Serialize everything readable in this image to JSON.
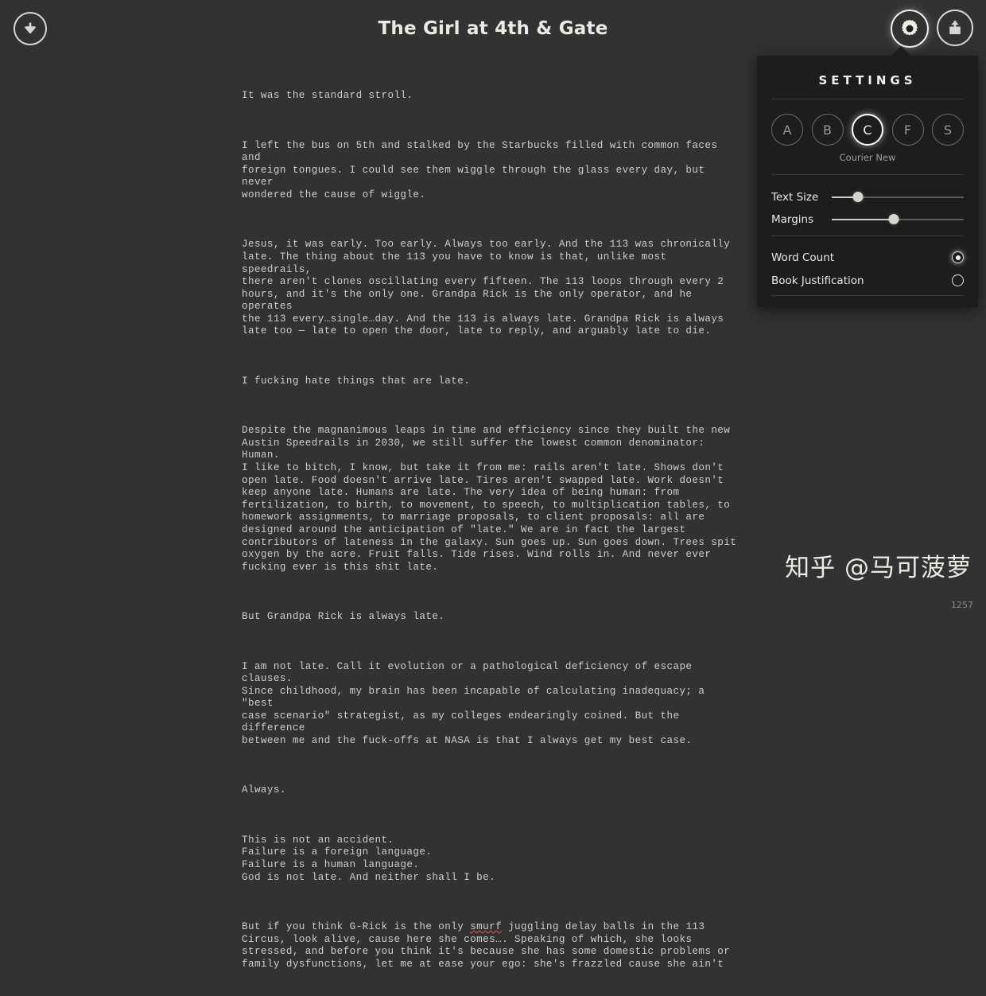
{
  "header": {
    "title": "The Girl at 4th & Gate",
    "download_icon": "arrow-down-circle-icon",
    "settings_icon": "gear-icon",
    "share_icon": "share-export-icon"
  },
  "document": {
    "paragraphs": [
      "It was the standard stroll.",
      "I left the bus on 5th and stalked by the Starbucks filled with common faces and\nforeign tongues. I could see them wiggle through the glass every day, but never\nwondered the cause of wiggle.",
      "Jesus, it was early. Too early. Always too early. And the 113 was chronically\nlate. The thing about the 113 you have to know is that, unlike most speedrails,\nthere aren't clones oscillating every fifteen. The 113 loops through every 2\nhours, and it's the only one. Grandpa Rick is the only operator, and he operates\nthe 113 every…single…day. And the 113 is always late. Grandpa Rick is always\nlate too — late to open the door, late to reply, and arguably late to die.",
      "I fucking hate things that are late.",
      "Despite the magnanimous leaps in time and efficiency since they built the new\nAustin Speedrails in 2030, we still suffer the lowest common denominator: Human.\nI like to bitch, I know, but take it from me: rails aren't late. Shows don't\nopen late. Food doesn't arrive late. Tires aren't swapped late. Work doesn't\nkeep anyone late. Humans are late. The very idea of being human: from\nfertilization, to birth, to movement, to speech, to multiplication tables, to\nhomework assignments, to marriage proposals, to client proposals: all are\ndesigned around the anticipation of \"late.\" We are in fact the largest\ncontributors of lateness in the galaxy. Sun goes up. Sun goes down. Trees spit\noxygen by the acre. Fruit falls. Tide rises. Wind rolls in. And never ever\nfucking ever is this shit late.",
      "But Grandpa Rick is always late.",
      "I am not late. Call it evolution or a pathological deficiency of escape clauses.\nSince childhood, my brain has been incapable of calculating inadequacy; a \"best\ncase scenario\" strategist, as my colleges endearingly coined. But the difference\nbetween me and the fuck-offs at NASA is that I always get my best case.",
      "Always.",
      "This is not an accident.\nFailure is a foreign language.\nFailure is a human language.\nGod is not late. And neither shall I be."
    ],
    "last_paragraph": {
      "before_misspelled": "But if you think G-Rick is the only ",
      "misspelled_word": "smurf",
      "after_misspelled": " juggling delay balls in the 113\nCircus, look alive, cause here she comes…. Speaking of which, she looks\nstressed, and before you think it's because she has some domestic problems or\nfamily dysfunctions, let me at ease your ego: she's frazzled cause she ain't"
    }
  },
  "settings": {
    "title": "SETTINGS",
    "fonts": [
      {
        "letter": "A",
        "selected": false
      },
      {
        "letter": "B",
        "selected": false
      },
      {
        "letter": "C",
        "selected": true
      },
      {
        "letter": "F",
        "selected": false
      },
      {
        "letter": "S",
        "selected": false
      }
    ],
    "selected_font_name": "Courier New",
    "sliders": [
      {
        "label": "Text Size",
        "value": 20
      },
      {
        "label": "Margins",
        "value": 47
      }
    ],
    "toggles": [
      {
        "label": "Word Count",
        "selected": true
      },
      {
        "label": "Book Justification",
        "selected": false
      }
    ]
  },
  "footer": {
    "watermark": "知乎 @马可菠萝",
    "word_count": "1257"
  },
  "colors": {
    "background": "#323232",
    "panel_background": "#1d1d1d",
    "text": "#cfcdc7",
    "accent": "#ffffff",
    "spellcheck": "#c94b4b"
  }
}
